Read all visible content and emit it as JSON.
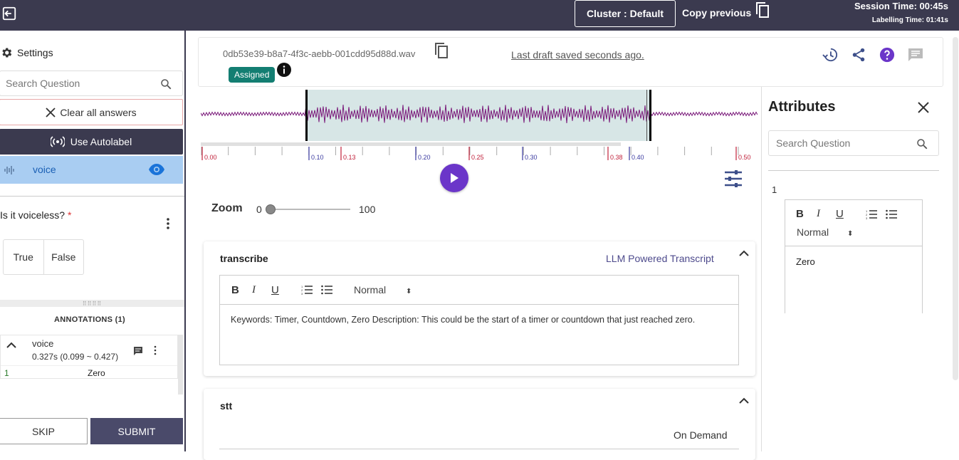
{
  "header": {
    "cluster_label": "Cluster : Default",
    "copy_previous_label": "Copy previous",
    "session_time": "Session Time: 00:45s",
    "labelling_time": "Labelling Time: 01:41s"
  },
  "sidebar": {
    "settings_label": "Settings",
    "search_placeholder": "Search Question",
    "clear_label": "Clear all answers",
    "autolabel_label": "Use Autolabel",
    "active_item_label": "voice",
    "question": "Is it voiceless?",
    "required_mark": "*",
    "options": [
      "True",
      "False"
    ],
    "annotations_header": "ANNOTATIONS (1)",
    "annotation": {
      "name": "voice",
      "duration": "0.327s (0.099 ~ 0.427)",
      "row_index": "1",
      "row_value": "Zero"
    },
    "skip_label": "SKIP",
    "submit_label": "SUBMIT"
  },
  "file": {
    "name": "0db53e39-b8a7-4f3c-aebb-001cdd95d88d.wav",
    "status_badge": "Assigned",
    "draft_status": "Last draft saved seconds ago."
  },
  "timeline": {
    "ticks": [
      "0.00",
      "0.10",
      "0.13",
      "0.20",
      "0.25",
      "0.30",
      "0.38",
      "0.40",
      "0.50"
    ]
  },
  "zoom": {
    "label": "Zoom",
    "min": "0",
    "max": "100",
    "value": 0
  },
  "transcribe": {
    "title": "transcribe",
    "right_label": "LLM Powered Transcript",
    "format": "Normal",
    "text": "Keywords: Timer, Countdown, Zero Description: This could be the start of a timer or countdown that just reached zero."
  },
  "stt": {
    "title": "stt",
    "right_label": "On Demand"
  },
  "attributes": {
    "title": "Attributes",
    "search_placeholder": "Search Question",
    "item_number": "1",
    "format": "Normal",
    "text": "Zero"
  },
  "colors": {
    "topbar": "#3b3a4f",
    "accent_purple": "#6b36c9",
    "badge_green": "#137e72",
    "selection_fill": "#d7e6e6",
    "waveform": "#7a1a7a"
  }
}
